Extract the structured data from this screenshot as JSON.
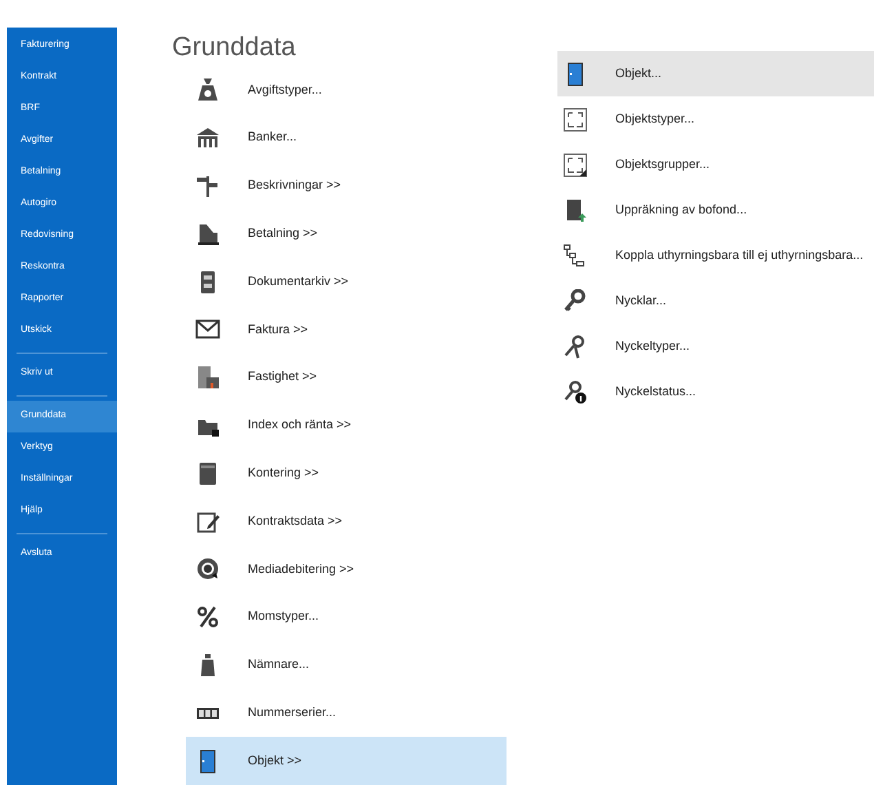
{
  "sidebar": {
    "items": [
      {
        "kind": "item",
        "label": "Fakturering",
        "selected": false
      },
      {
        "kind": "item",
        "label": "Kontrakt",
        "selected": false
      },
      {
        "kind": "item",
        "label": "BRF",
        "selected": false
      },
      {
        "kind": "item",
        "label": "Avgifter",
        "selected": false
      },
      {
        "kind": "item",
        "label": "Betalning",
        "selected": false
      },
      {
        "kind": "item",
        "label": "Autogiro",
        "selected": false
      },
      {
        "kind": "item",
        "label": "Redovisning",
        "selected": false
      },
      {
        "kind": "item",
        "label": "Reskontra",
        "selected": false
      },
      {
        "kind": "item",
        "label": "Rapporter",
        "selected": false
      },
      {
        "kind": "item",
        "label": "Utskick",
        "selected": false
      },
      {
        "kind": "separator"
      },
      {
        "kind": "item",
        "label": "Skriv ut",
        "selected": false
      },
      {
        "kind": "separator"
      },
      {
        "kind": "item",
        "label": "Grunddata",
        "selected": true
      },
      {
        "kind": "item",
        "label": "Verktyg",
        "selected": false
      },
      {
        "kind": "item",
        "label": "Inställningar",
        "selected": false
      },
      {
        "kind": "item",
        "label": "Hjälp",
        "selected": false
      },
      {
        "kind": "separator"
      },
      {
        "kind": "item",
        "label": "Avsluta",
        "selected": false
      }
    ]
  },
  "title": "Grunddata",
  "categories": [
    {
      "label": "Avgiftstyper...",
      "selected": false
    },
    {
      "label": "Banker...",
      "selected": false
    },
    {
      "label": "Beskrivningar >>",
      "selected": false
    },
    {
      "label": "Betalning >>",
      "selected": false
    },
    {
      "label": "Dokumentarkiv >>",
      "selected": false
    },
    {
      "label": "Faktura >>",
      "selected": false
    },
    {
      "label": "Fastighet >>",
      "selected": false
    },
    {
      "label": "Index och ränta >>",
      "selected": false
    },
    {
      "label": "Kontering >>",
      "selected": false
    },
    {
      "label": "Kontraktsdata >>",
      "selected": false
    },
    {
      "label": "Mediadebitering >>",
      "selected": false
    },
    {
      "label": "Momstyper...",
      "selected": false
    },
    {
      "label": "Nämnare...",
      "selected": false
    },
    {
      "label": "Nummerserier...",
      "selected": false
    },
    {
      "label": "Objekt >>",
      "selected": true
    }
  ],
  "subitems": [
    {
      "label": "Objekt...",
      "hovered": true
    },
    {
      "label": "Objektstyper...",
      "hovered": false
    },
    {
      "label": "Objektsgrupper...",
      "hovered": false
    },
    {
      "label": "Uppräkning av bofond...",
      "hovered": false
    },
    {
      "label": "Koppla uthyrningsbara till ej uthyrningsbara...",
      "hovered": false
    },
    {
      "label": "Nycklar...",
      "hovered": false
    },
    {
      "label": "Nyckeltyper...",
      "hovered": false
    },
    {
      "label": "Nyckelstatus...",
      "hovered": false
    }
  ]
}
